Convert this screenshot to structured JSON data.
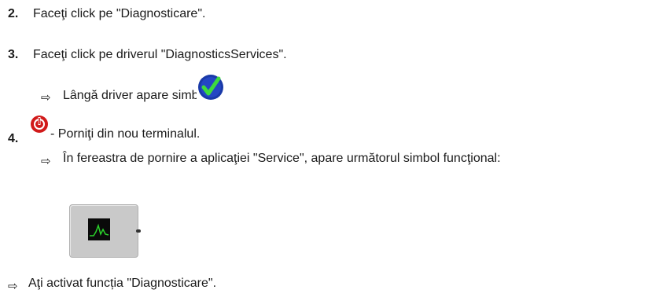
{
  "steps": [
    {
      "number": "2.",
      "text": "Faceţi click pe \"Diagnosticare\"."
    },
    {
      "number": "3.",
      "text": "Faceţi click pe driverul \"DiagnosticsServices\"."
    },
    {
      "number": "4.",
      "text": " - Porniţi din nou terminalul."
    }
  ],
  "results": {
    "result_arrow": "⇨",
    "step3_result": "Lângă driver apare simbolul",
    "step4_result": "În fereastra de pornire a aplicaţiei \"Service\", apare următorul simbol funcţional:",
    "final": "Aţi activat funcția \"Diagnosticare\"."
  },
  "icons": {
    "check": "checkmark-icon",
    "power": "restart-icon",
    "diagnostics": "diagnostics-function-icon"
  },
  "colors": {
    "check_bg": "#1a3aa8",
    "check_mark": "#3ddc3d",
    "power": "#d11a1a",
    "waveform": "#2bd22b"
  }
}
